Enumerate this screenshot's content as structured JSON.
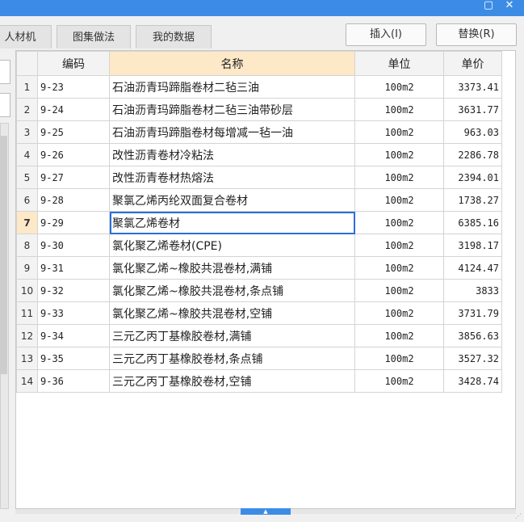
{
  "titlebar": {
    "maximize_icon": "▢",
    "close_icon": "✕"
  },
  "tabs": [
    {
      "label": "人材机"
    },
    {
      "label": "图集做法"
    },
    {
      "label": "我的数据"
    }
  ],
  "toolbar": {
    "insert_label": "插入(I)",
    "replace_label": "替换(R)"
  },
  "table": {
    "columns": [
      "编码",
      "名称",
      "单位",
      "单价"
    ],
    "rows": [
      {
        "no": "1",
        "code": "9-23",
        "name": "石油沥青玛蹄脂卷材二毡三油",
        "unit": "100m2",
        "price": "3373.41"
      },
      {
        "no": "2",
        "code": "9-24",
        "name": "石油沥青玛蹄脂卷材二毡三油带砂层",
        "unit": "100m2",
        "price": "3631.77"
      },
      {
        "no": "3",
        "code": "9-25",
        "name": "石油沥青玛蹄脂卷材每增减一毡一油",
        "unit": "100m2",
        "price": "963.03"
      },
      {
        "no": "4",
        "code": "9-26",
        "name": "改性沥青卷材冷粘法",
        "unit": "100m2",
        "price": "2286.78"
      },
      {
        "no": "5",
        "code": "9-27",
        "name": "改性沥青卷材热熔法",
        "unit": "100m2",
        "price": "2394.01"
      },
      {
        "no": "6",
        "code": "9-28",
        "name": "聚氯乙烯丙纶双面复合卷材",
        "unit": "100m2",
        "price": "1738.27"
      },
      {
        "no": "7",
        "code": "9-29",
        "name": "聚氯乙烯卷材",
        "unit": "100m2",
        "price": "6385.16"
      },
      {
        "no": "8",
        "code": "9-30",
        "name": "氯化聚乙烯卷材(CPE)",
        "unit": "100m2",
        "price": "3198.17"
      },
      {
        "no": "9",
        "code": "9-31",
        "name": "氯化聚乙烯~橡胶共混卷材,满铺",
        "unit": "100m2",
        "price": "4124.47"
      },
      {
        "no": "10",
        "code": "9-32",
        "name": "氯化聚乙烯~橡胶共混卷材,条点铺",
        "unit": "100m2",
        "price": "3833"
      },
      {
        "no": "11",
        "code": "9-33",
        "name": "氯化聚乙烯~橡胶共混卷材,空铺",
        "unit": "100m2",
        "price": "3731.79"
      },
      {
        "no": "12",
        "code": "9-34",
        "name": "三元乙丙丁基橡胶卷材,满铺",
        "unit": "100m2",
        "price": "3856.63"
      },
      {
        "no": "13",
        "code": "9-35",
        "name": "三元乙丙丁基橡胶卷材,条点铺",
        "unit": "100m2",
        "price": "3527.32"
      },
      {
        "no": "14",
        "code": "9-36",
        "name": "三元乙丙丁基橡胶卷材,空铺",
        "unit": "100m2",
        "price": "3428.74"
      }
    ],
    "selected_row": "7"
  },
  "scroll": {
    "up_icon": "▲",
    "down_icon": "▼"
  }
}
